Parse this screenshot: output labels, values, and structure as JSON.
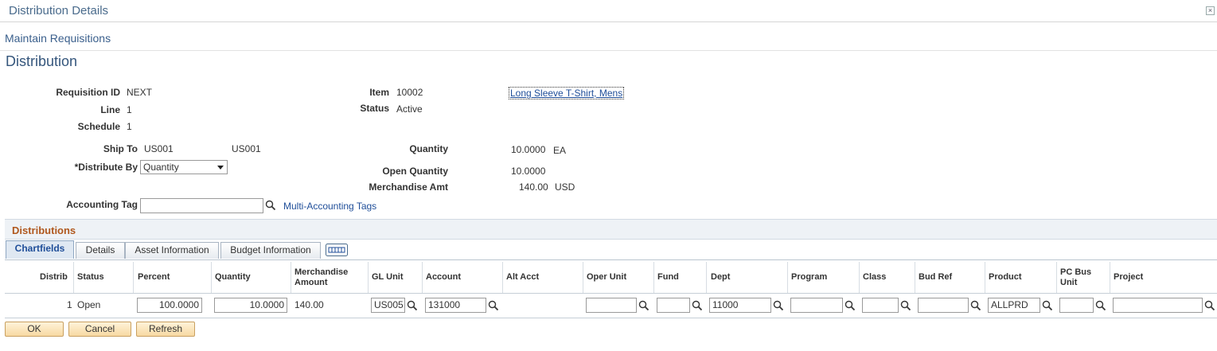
{
  "window": {
    "title": "Distribution Details"
  },
  "breadcrumb": "Maintain Requisitions",
  "page_title": "Distribution",
  "header": {
    "requisition_id_label": "Requisition ID",
    "requisition_id": "NEXT",
    "line_label": "Line",
    "line": "1",
    "schedule_label": "Schedule",
    "schedule": "1",
    "item_label": "Item",
    "item": "10002",
    "item_desc": "Long Sleeve T-Shirt, Mens",
    "status_label": "Status",
    "status": "Active",
    "ship_to_label": "Ship To",
    "ship_to": "US001",
    "ship_to_desc": "US001",
    "distribute_by_label": "*Distribute By",
    "distribute_by": "Quantity",
    "quantity_label": "Quantity",
    "quantity": "10.0000",
    "quantity_uom": "EA",
    "open_quantity_label": "Open Quantity",
    "open_quantity": "10.0000",
    "merch_amt_label": "Merchandise Amt",
    "merch_amt": "140.00",
    "currency": "USD",
    "accounting_tag_label": "Accounting Tag",
    "accounting_tag": "",
    "multi_accounting_tags": "Multi-Accounting Tags"
  },
  "grid": {
    "title": "Distributions",
    "tabs": [
      "Chartfields",
      "Details",
      "Asset Information",
      "Budget Information"
    ],
    "columns": {
      "distrib": "Distrib",
      "status": "Status",
      "percent": "Percent",
      "quantity": "Quantity",
      "merch_amount": "Merchandise Amount",
      "gl_unit": "GL Unit",
      "account": "Account",
      "alt_acct": "Alt Acct",
      "oper_unit": "Oper Unit",
      "fund": "Fund",
      "dept": "Dept",
      "program": "Program",
      "class": "Class",
      "bud_ref": "Bud Ref",
      "product": "Product",
      "pc_bus_unit": "PC Bus Unit",
      "project": "Project"
    },
    "row": {
      "distrib": "1",
      "status": "Open",
      "percent": "100.0000",
      "quantity": "10.0000",
      "merch_amount": "140.00",
      "gl_unit": "US005",
      "account": "131000",
      "oper_unit": "",
      "fund": "",
      "dept": "11000",
      "program": "",
      "class": "",
      "bud_ref": "",
      "product": "ALLPRD",
      "pc_bus_unit": "",
      "project": ""
    }
  },
  "buttons": {
    "ok": "OK",
    "cancel": "Cancel",
    "refresh": "Refresh"
  }
}
